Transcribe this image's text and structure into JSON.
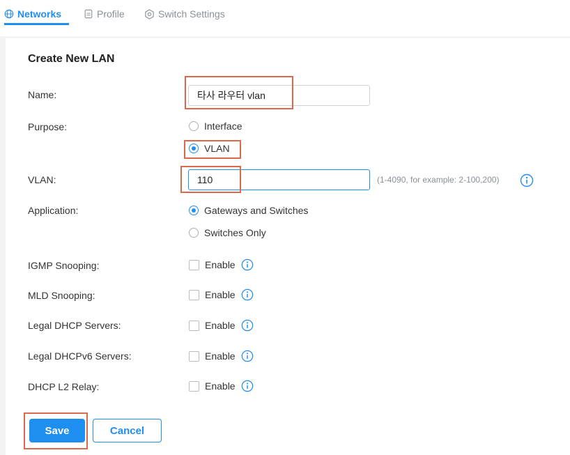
{
  "tabs": [
    {
      "label": "Networks",
      "icon": "globe-icon",
      "active": true
    },
    {
      "label": "Profile",
      "icon": "profile-icon",
      "active": false
    },
    {
      "label": "Switch Settings",
      "icon": "gear-icon",
      "active": false
    }
  ],
  "form": {
    "title": "Create New LAN",
    "name": {
      "label": "Name:",
      "value": "타사 라우터  vlan"
    },
    "purpose": {
      "label": "Purpose:",
      "options": [
        "Interface",
        "VLAN"
      ],
      "selected": "VLAN"
    },
    "vlan": {
      "label": "VLAN:",
      "value": "110",
      "hint": "(1-4090, for example: 2-100,200)"
    },
    "application": {
      "label": "Application:",
      "options": [
        "Gateways and Switches",
        "Switches Only"
      ],
      "selected": "Gateways and Switches"
    },
    "options": [
      {
        "label": "IGMP Snooping:",
        "checkbox": "Enable",
        "checked": false
      },
      {
        "label": "MLD Snooping:",
        "checkbox": "Enable",
        "checked": false
      },
      {
        "label": "Legal DHCP Servers:",
        "checkbox": "Enable",
        "checked": false
      },
      {
        "label": "Legal DHCPv6 Servers:",
        "checkbox": "Enable",
        "checked": false
      },
      {
        "label": "DHCP L2 Relay:",
        "checkbox": "Enable",
        "checked": false
      }
    ]
  },
  "buttons": {
    "save": "Save",
    "cancel": "Cancel"
  },
  "colors": {
    "accent": "#1f8ef1",
    "highlight": "#d9694a"
  }
}
